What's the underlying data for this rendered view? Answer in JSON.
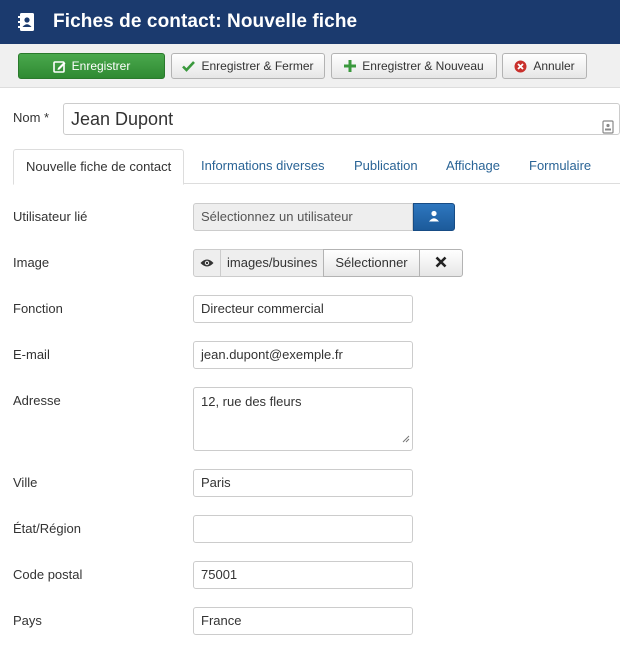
{
  "header": {
    "title": "Fiches de contact: Nouvelle fiche",
    "icon": "address-book-icon"
  },
  "toolbar": {
    "save_label": "Enregistrer",
    "save_close_label": "Enregistrer & Fermer",
    "save_new_label": "Enregistrer & Nouveau",
    "cancel_label": "Annuler"
  },
  "name": {
    "label": "Nom *",
    "value": "Jean Dupont"
  },
  "tabs": [
    {
      "label": "Nouvelle fiche de contact",
      "active": true
    },
    {
      "label": "Informations diverses",
      "active": false
    },
    {
      "label": "Publication",
      "active": false
    },
    {
      "label": "Affichage",
      "active": false
    },
    {
      "label": "Formulaire",
      "active": false
    }
  ],
  "form": {
    "user": {
      "label": "Utilisateur lié",
      "placeholder": "Sélectionnez un utilisateur"
    },
    "image": {
      "label": "Image",
      "value": "images/busines",
      "select_label": "Sélectionner"
    },
    "position": {
      "label": "Fonction",
      "value": "Directeur commercial"
    },
    "email": {
      "label": "E-mail",
      "value": "jean.dupont@exemple.fr"
    },
    "address": {
      "label": "Adresse",
      "value": "12, rue des fleurs"
    },
    "city": {
      "label": "Ville",
      "value": "Paris"
    },
    "state": {
      "label": "État/Région",
      "value": ""
    },
    "postcode": {
      "label": "Code postal",
      "value": "75001"
    },
    "country": {
      "label": "Pays",
      "value": "France"
    }
  },
  "colors": {
    "header_bg": "#1b3a6e",
    "save_button": "#3a993d",
    "user_button": "#2467ad",
    "link": "#2a6496"
  }
}
